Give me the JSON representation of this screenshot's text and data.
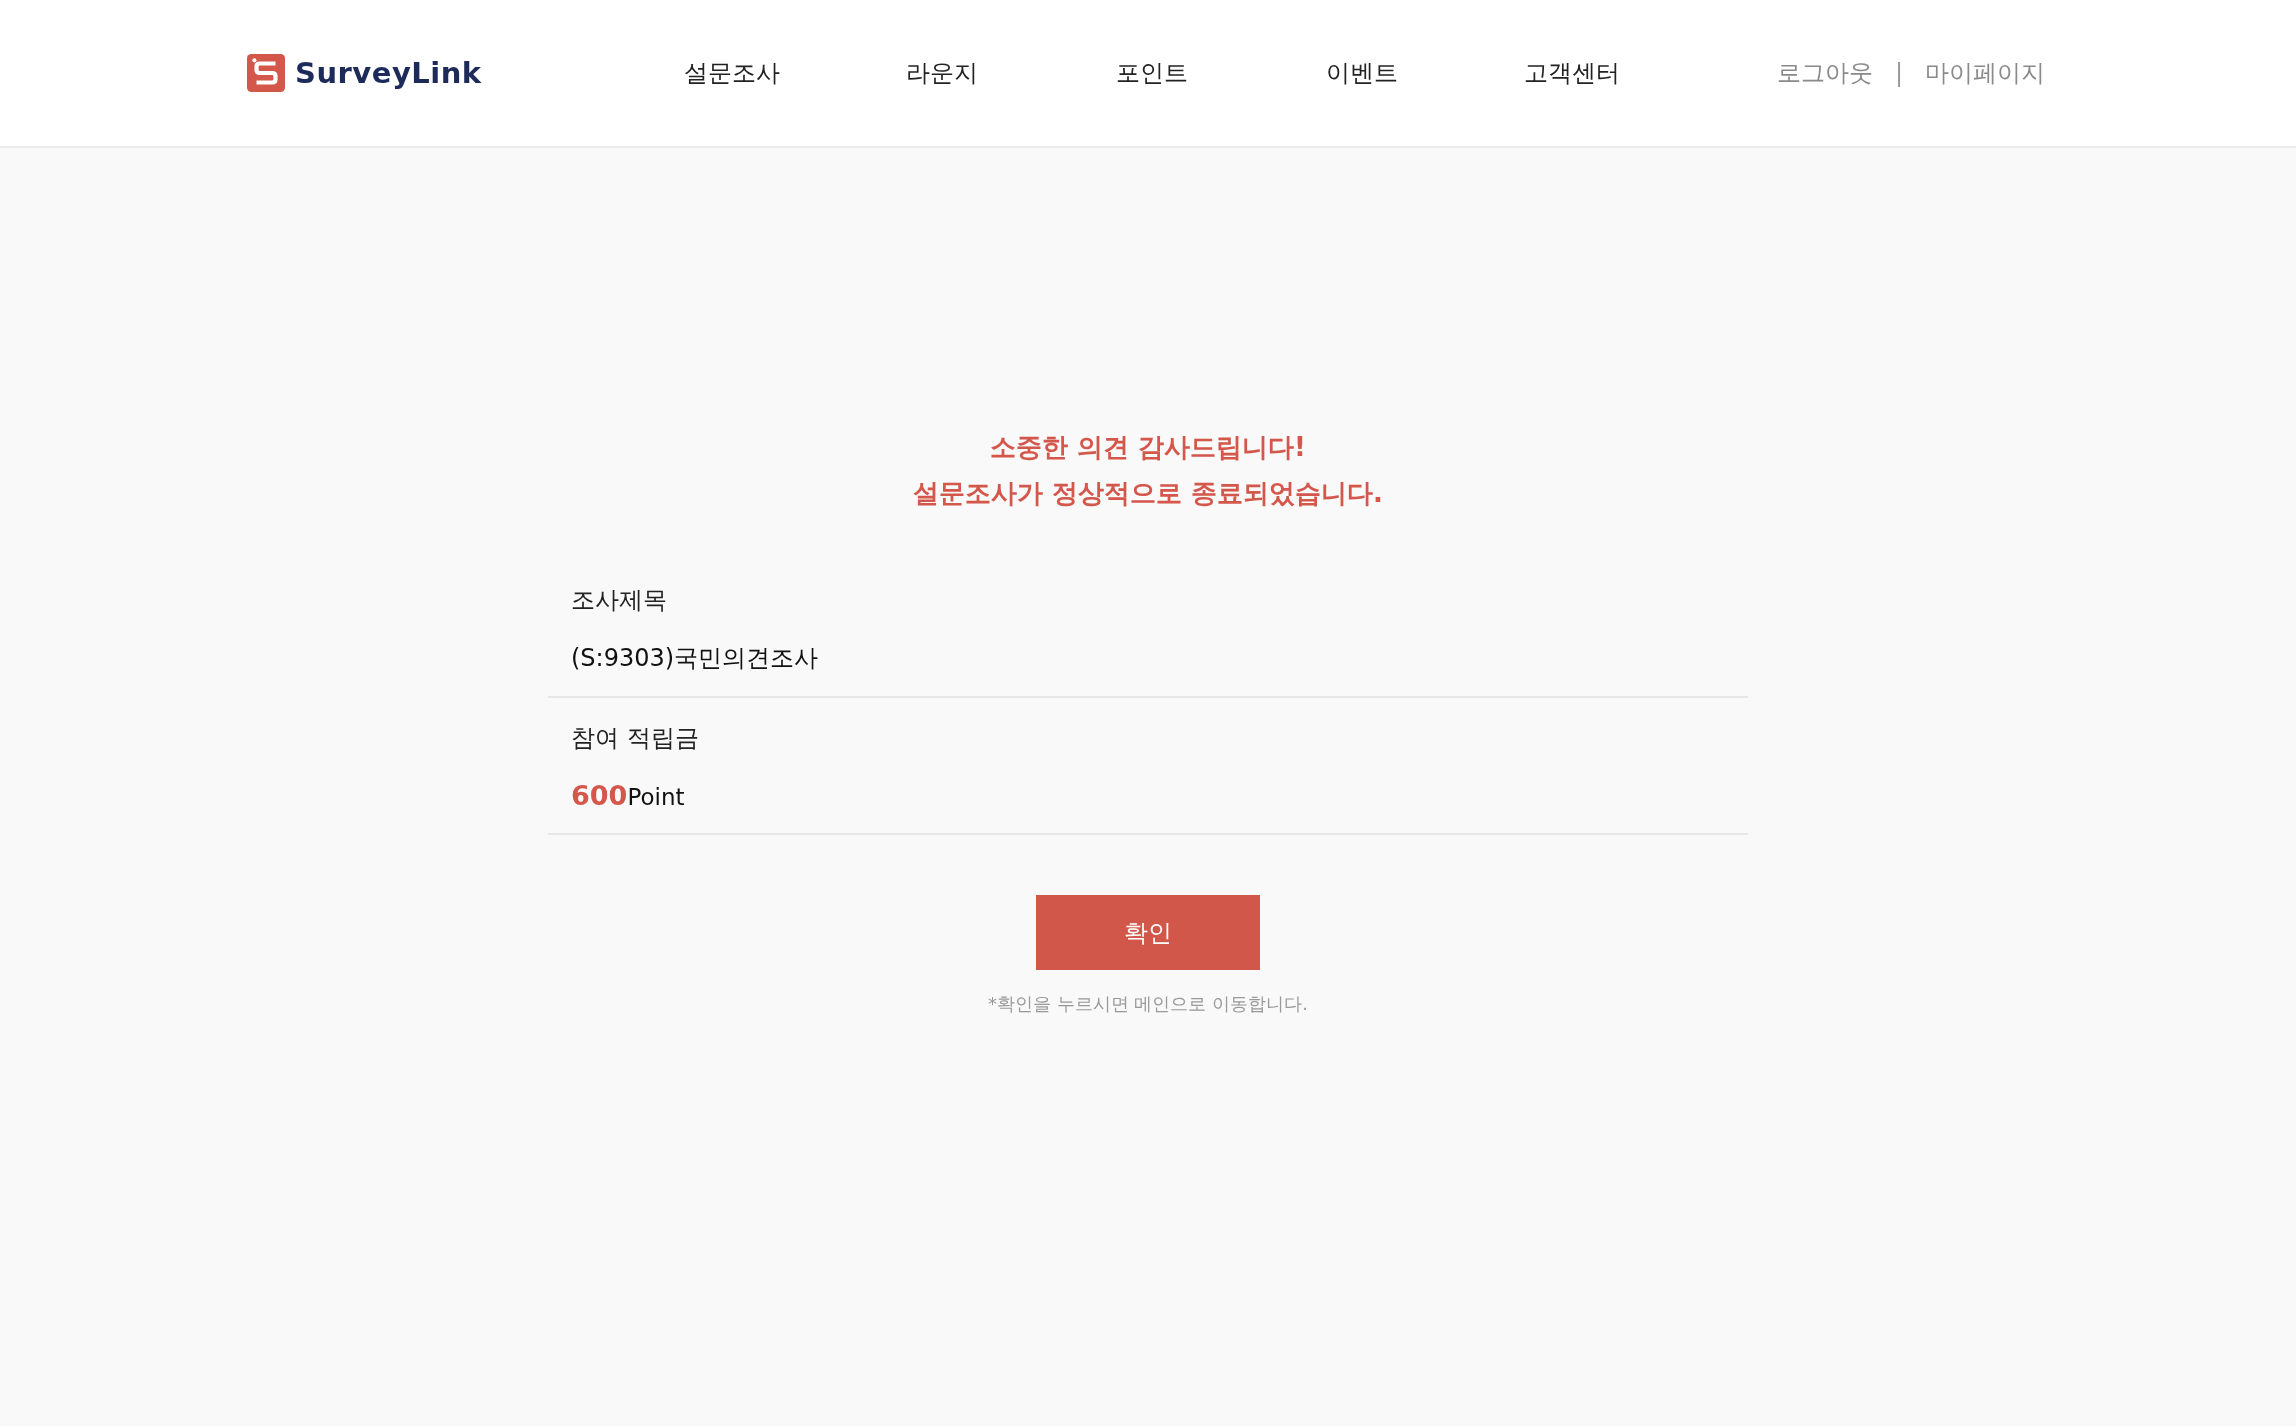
{
  "header": {
    "logo": {
      "text": "SurveyLink"
    },
    "nav": [
      {
        "label": "설문조사"
      },
      {
        "label": "라운지"
      },
      {
        "label": "포인트"
      },
      {
        "label": "이벤트"
      },
      {
        "label": "고객센터"
      }
    ],
    "user_links": [
      {
        "label": "로그아웃"
      },
      {
        "label": "마이페이지"
      }
    ],
    "separator": "|"
  },
  "message": {
    "lines": [
      "소중한 의견 감사드립니다!",
      "설문조사가 정상적으로 종료되었습니다."
    ]
  },
  "fields": [
    {
      "kind": "text",
      "label": "조사제목",
      "value": "(S:9303)국민의견조사"
    },
    {
      "kind": "points",
      "label": "참여 적립금",
      "amount": "600",
      "unit": "Point"
    }
  ],
  "confirm_button": "확인",
  "note": "*확인을 누르시면 메인으로 이동합니다."
}
